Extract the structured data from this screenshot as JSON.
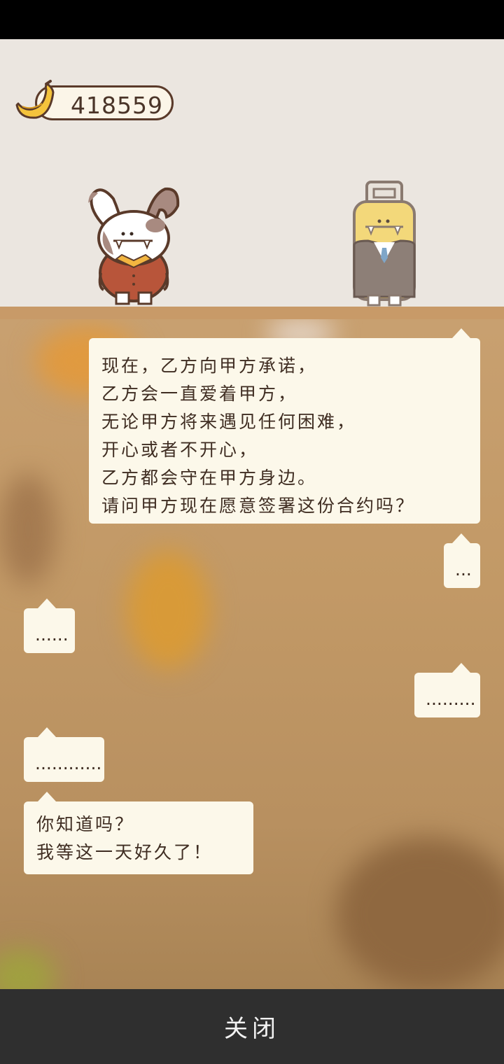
{
  "hud": {
    "banana_count": "418559",
    "banana_icon": "banana-icon"
  },
  "characters": {
    "left": "rabbit-character",
    "right": "office-worker-character"
  },
  "dialogue": [
    {
      "side": "right",
      "lines": [
        "现在，乙方向甲方承诺，",
        "乙方会一直爱着甲方，",
        "无论甲方将来遇见任何困难，",
        "开心或者不开心，",
        "乙方都会守在甲方身边。",
        "请问甲方现在愿意签署这份合约吗？"
      ]
    },
    {
      "side": "right",
      "lines": [
        "..."
      ]
    },
    {
      "side": "left",
      "lines": [
        "......"
      ]
    },
    {
      "side": "right",
      "lines": [
        "........."
      ]
    },
    {
      "side": "left",
      "lines": [
        "............"
      ]
    },
    {
      "side": "left",
      "lines": [
        "你知道吗？",
        "我等这一天好久了！"
      ]
    }
  ],
  "footer": {
    "close_label": "关闭"
  },
  "colors": {
    "stage_bg": "#ebe6e0",
    "bubble_bg": "#fcf8ea",
    "footer_bg": "#2f2f2f",
    "floor": "#c89a68"
  }
}
